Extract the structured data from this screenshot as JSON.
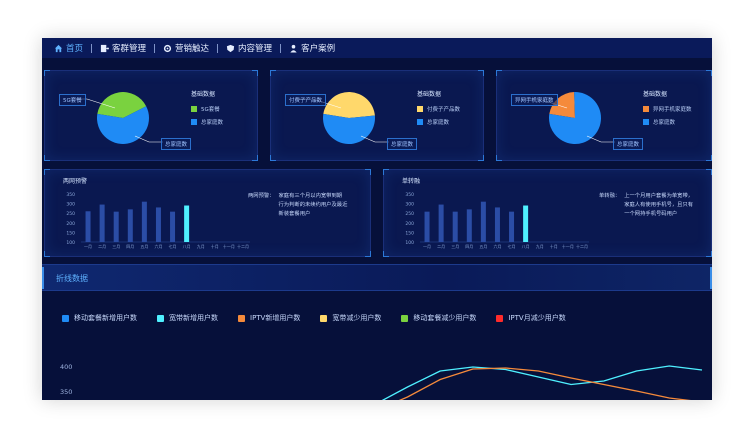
{
  "nav": {
    "items": [
      {
        "label": "首页",
        "icon": "home-icon",
        "active": true
      },
      {
        "label": "客群管理",
        "icon": "customer-group-icon",
        "active": false
      },
      {
        "label": "营销触达",
        "icon": "gear-icon",
        "active": false
      },
      {
        "label": "内容管理",
        "icon": "shield-icon",
        "active": false
      },
      {
        "label": "客户案例",
        "icon": "user-icon",
        "active": false
      }
    ]
  },
  "pies": [
    {
      "title": "基础数据",
      "legend": [
        "5G套餐",
        "总家庭数"
      ],
      "colors": [
        "#7ad23f",
        "#1f8bf5"
      ],
      "callout_left": "5G套餐",
      "callout_bottom": "总家庭数",
      "chart_data": {
        "type": "pie",
        "categories": [
          "5G套餐",
          "总家庭数"
        ],
        "values": [
          40,
          60
        ]
      }
    },
    {
      "title": "基础数据",
      "legend": [
        "付费子产品数",
        "总家庭数"
      ],
      "colors": [
        "#ffd86b",
        "#1f8bf5"
      ],
      "callout_left": "付费子产品数",
      "callout_bottom": "总家庭数",
      "chart_data": {
        "type": "pie",
        "categories": [
          "付费子产品数",
          "总家庭数"
        ],
        "values": [
          46,
          54
        ]
      }
    },
    {
      "title": "基础数据",
      "legend": [
        "异网手机家庭数",
        "总家庭数"
      ],
      "colors": [
        "#f58a3b",
        "#1f8bf5"
      ],
      "callout_left": "异网手机家庭数",
      "callout_bottom": "总家庭数",
      "chart_data": {
        "type": "pie",
        "categories": [
          "异网手机家庭数",
          "总家庭数"
        ],
        "values": [
          22,
          78
        ]
      }
    }
  ],
  "bar_panels": [
    {
      "title": "两网预警",
      "desc_label": "两网预警：",
      "desc_text": [
        "家庭有三个月以内宽带到期",
        "行为判断的未续约用户及最近",
        "新装套餐用户"
      ],
      "chart_data": {
        "type": "bar",
        "categories": [
          "一月",
          "二月",
          "三月",
          "四月",
          "五月",
          "六月",
          "七月",
          "八月",
          "九月",
          "十月",
          "十一月",
          "十二月"
        ],
        "values": [
          260,
          295,
          258,
          270,
          310,
          280,
          258,
          290,
          null,
          null,
          null,
          null
        ],
        "highlight_index": 7,
        "yticks": [
          "350",
          "300",
          "250",
          "200",
          "150",
          "100"
        ],
        "ylim": [
          100,
          350
        ]
      }
    },
    {
      "title": "单转融",
      "desc_label": "单转融：",
      "desc_text": [
        "上一个月用户套餐为单宽带，",
        "家庭人有使用手机号，且只有",
        "一个网持手机号码用户"
      ],
      "chart_data": {
        "type": "bar",
        "categories": [
          "一月",
          "二月",
          "三月",
          "四月",
          "五月",
          "六月",
          "七月",
          "八月",
          "九月",
          "十月",
          "十一月",
          "十二月"
        ],
        "values": [
          258,
          295,
          258,
          270,
          310,
          280,
          258,
          290,
          null,
          null,
          null,
          null
        ],
        "highlight_index": 7,
        "yticks": [
          "350",
          "300",
          "250",
          "200",
          "150",
          "100"
        ],
        "ylim": [
          100,
          350
        ]
      }
    }
  ],
  "line_section": {
    "title": "折线数据",
    "legend": [
      {
        "label": "移动套餐新增用户数",
        "color": "#1f8bf5"
      },
      {
        "label": "宽带新增用户数",
        "color": "#4ff0ff"
      },
      {
        "label": "IPTV新增用户数",
        "color": "#f58a3b"
      },
      {
        "label": "宽带减少用户数",
        "color": "#ffd86b"
      },
      {
        "label": "移动套餐减少用户数",
        "color": "#7ad23f"
      },
      {
        "label": "IPTV月减少用户数",
        "color": "#ff2b2b"
      }
    ],
    "yticks": [
      "400",
      "350"
    ],
    "chart_data": {
      "type": "line",
      "x": [
        1,
        2,
        3,
        4,
        5,
        6,
        7,
        8,
        9,
        10,
        11,
        12
      ],
      "series": [
        {
          "name": "宽带新增用户数",
          "values": [
            310,
            325,
            360,
            392,
            400,
            395,
            380,
            365,
            372,
            392,
            402,
            394
          ]
        },
        {
          "name": "IPTV新增用户数",
          "values": [
            300,
            312,
            340,
            375,
            396,
            398,
            392,
            378,
            365,
            352,
            338,
            330
          ]
        }
      ]
    }
  }
}
